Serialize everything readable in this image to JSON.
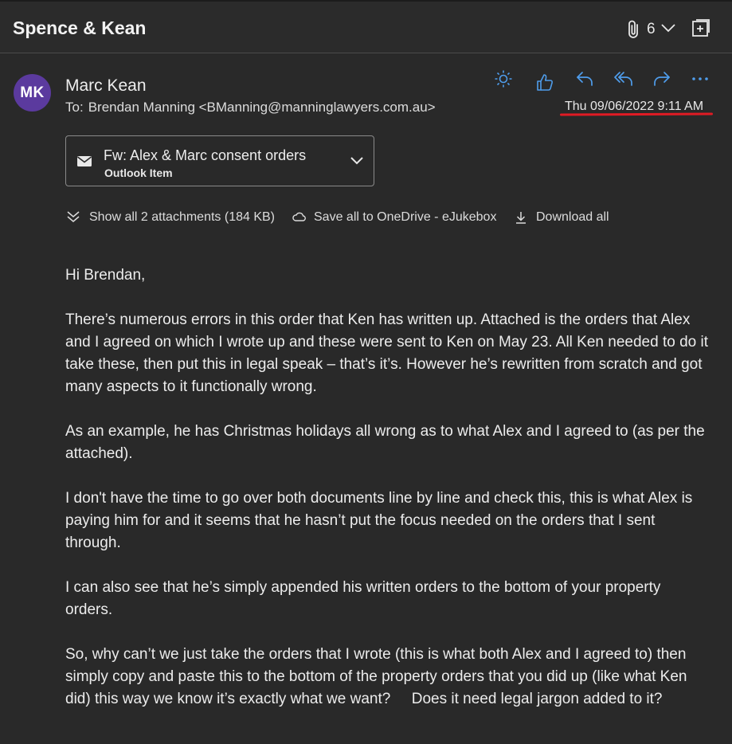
{
  "window": {
    "title": "Spence & Kean",
    "attachment_count": "6"
  },
  "message": {
    "avatar_initials": "MK",
    "sender_name": "Marc Kean",
    "to_label": "To:",
    "recipient": "Brendan Manning <BManning@manninglawyers.com.au>",
    "date": "Thu 09/06/2022 9:11 AM"
  },
  "actions": [
    {
      "icon": "sun-icon"
    },
    {
      "icon": "thumbs-up-icon"
    },
    {
      "icon": "reply-icon"
    },
    {
      "icon": "reply-all-icon"
    },
    {
      "icon": "forward-icon"
    },
    {
      "icon": "more-icon"
    }
  ],
  "attachment": {
    "name": "Fw: Alex & Marc consent orders",
    "type": "Outlook Item"
  },
  "attachment_bar": {
    "show_all": "Show all 2 attachments (184 KB)",
    "save_onedrive": "Save all to OneDrive - eJukebox",
    "download_all": "Download all"
  },
  "body": {
    "greeting": "Hi Brendan,",
    "p1": "There’s numerous errors in this order that Ken has written up.  Attached is the orders that Alex and I agreed on which I wrote up and these were sent to Ken on May 23. All Ken needed to do it take these, then put this in legal speak – that’s it’s. However he’s rewritten from scratch and got many aspects to it functionally wrong.",
    "p2": "As an example, he has Christmas holidays all wrong as to what Alex and I agreed to (as per the attached).",
    "p3": "I don't have the time to go over both documents line by line and check this, this is what Alex is paying him for and it seems that he hasn’t put the focus needed on the orders that I sent through.",
    "p4": "I can also see that he’s simply appended his written orders to the bottom of your property orders.",
    "p5": "So, why can’t we just take the orders that I wrote (this is what both Alex and I agreed to) then simply copy and paste this to the bottom of the property orders that you did up (like what Ken did) this way we know it’s exactly what we want?     Does it need legal jargon added to it?"
  },
  "colors": {
    "background": "#292929",
    "accent": "#4f9dec",
    "avatar": "#5b3a9e",
    "highlight_underline": "#e01b24"
  }
}
